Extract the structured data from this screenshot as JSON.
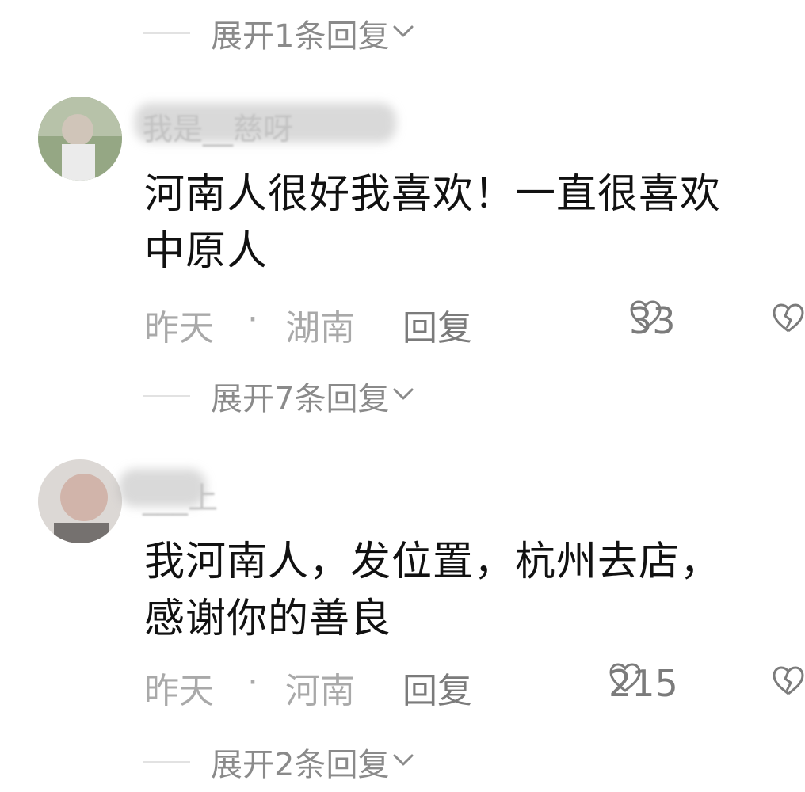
{
  "expanders": [
    "展开1条回复",
    "展开7条回复",
    "展开2条回复"
  ],
  "comments": [
    {
      "username": "我是__慈呀",
      "content_lines": [
        "河南人很好我喜欢！一直很喜欢",
        "中原人"
      ],
      "time": "昨天",
      "separator": "·",
      "location": "湖南",
      "reply_label": "回复",
      "likes": "33"
    },
    {
      "username": "___上",
      "content_lines": [
        "我河南人，发位置，杭州去店，",
        "感谢你的善良"
      ],
      "time": "昨天",
      "separator": "·",
      "location": "河南",
      "reply_label": "回复",
      "likes": "215"
    }
  ],
  "icons": {
    "like": "heart-outline-icon",
    "dislike": "broken-heart-icon",
    "expand": "chevron-down-icon"
  },
  "colors": {
    "primary_text": "#111111",
    "secondary_text": "#a9a9a9",
    "action_text": "#7b7b7b"
  }
}
